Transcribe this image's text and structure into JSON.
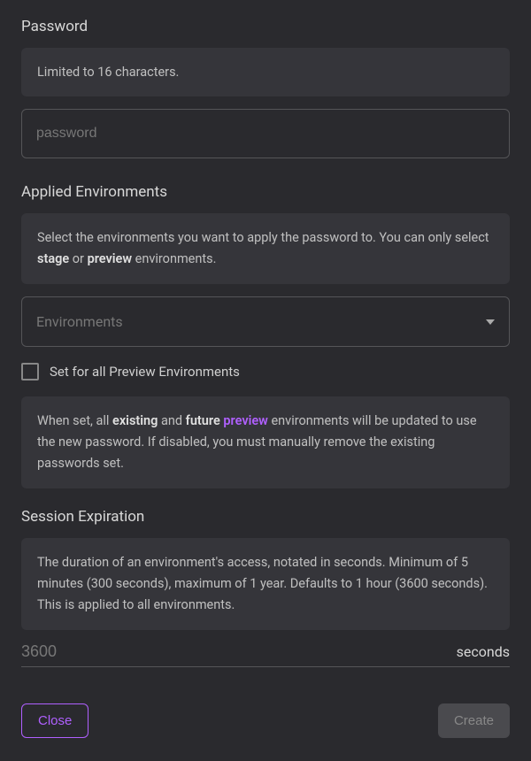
{
  "password": {
    "title": "Password",
    "hint": "Limited to 16 characters.",
    "placeholder": "password"
  },
  "environments": {
    "title": "Applied Environments",
    "hint_prefix": "Select the environments you want to apply the password to. You can only select ",
    "hint_stage": "stage",
    "hint_or": " or ",
    "hint_preview": "preview",
    "hint_suffix": " environments.",
    "select_placeholder": "Environments",
    "checkbox_label": "Set for all Preview Environments",
    "checkbox_checked": false,
    "preview_hint_1": "When set, all ",
    "preview_hint_existing": "existing",
    "preview_hint_and": " and ",
    "preview_hint_future": "future",
    "preview_hint_space": " ",
    "preview_hint_link": "preview",
    "preview_hint_2": " environments will be updated to use the new password. If disabled, you must manually remove the existing passwords set."
  },
  "session": {
    "title": "Session Expiration",
    "hint": "The duration of an environment's access, notated in seconds. Minimum of 5 minutes (300 seconds), maximum of 1 year. Defaults to 1 hour (3600 seconds). This is applied to all environments.",
    "placeholder": "3600",
    "unit": "seconds"
  },
  "footer": {
    "close_label": "Close",
    "create_label": "Create"
  }
}
